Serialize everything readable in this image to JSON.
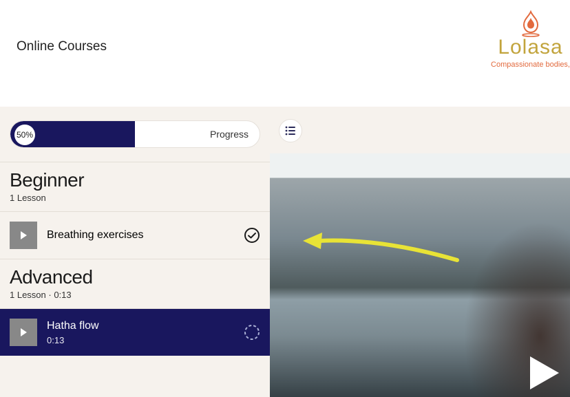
{
  "header": {
    "page_title": "Online Courses",
    "brand_name": "Lolasa",
    "brand_tagline": "Compassionate bodies,"
  },
  "progress": {
    "percent_label": "50%",
    "fill_percent": 50,
    "label": "Progress"
  },
  "sections": [
    {
      "title": "Beginner",
      "subtitle": "1 Lesson",
      "lessons": [
        {
          "title": "Breathing exercises",
          "time": "",
          "status": "complete",
          "active": false
        }
      ]
    },
    {
      "title": "Advanced",
      "subtitle": "1 Lesson · 0:13",
      "lessons": [
        {
          "title": "Hatha flow",
          "time": "0:13",
          "status": "incomplete",
          "active": true
        }
      ]
    }
  ],
  "icons": {
    "list_toggle": "list-icon",
    "play_small": "play-icon",
    "play_large": "play-icon",
    "check": "check-circle-icon",
    "pending": "dashed-circle-icon",
    "brand_flame": "flame-drop-icon"
  },
  "colors": {
    "accent_dark": "#19175e",
    "brand_gold": "#c2a43d",
    "brand_orange": "#e26a3e",
    "arrow": "#e8e336"
  }
}
